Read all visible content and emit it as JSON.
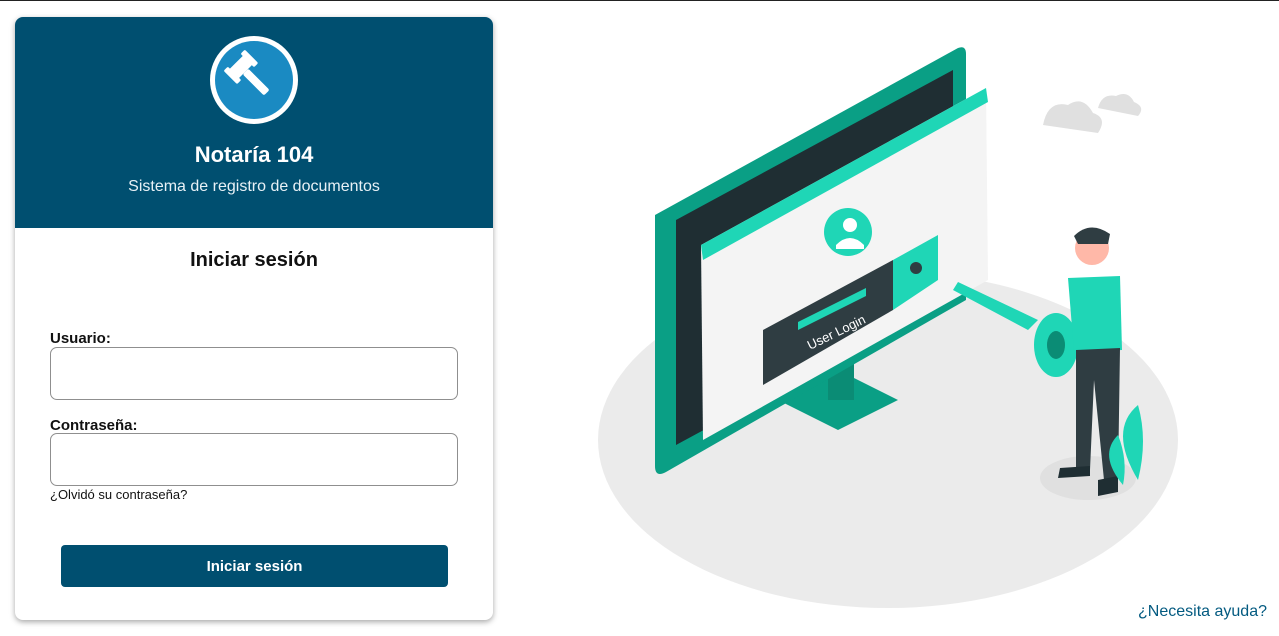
{
  "brand": {
    "name": "Notaría 104",
    "subtitle": "Sistema de registro de documentos",
    "logo_icon": "gavel-icon",
    "colors": {
      "header": "#004f70",
      "logo_circle": "#1a8ac2",
      "button": "#004f70",
      "accent": "#1fd6b6"
    }
  },
  "login": {
    "heading": "Iniciar sesión",
    "username_label": "Usuario:",
    "username_value": "",
    "password_label": "Contraseña:",
    "password_value": "",
    "forgot_link": "¿Olvidó su contraseña?",
    "submit_label": "Iniciar sesión"
  },
  "illustration": {
    "screen_text": "User Login"
  },
  "help_link": "¿Necesita ayuda?"
}
